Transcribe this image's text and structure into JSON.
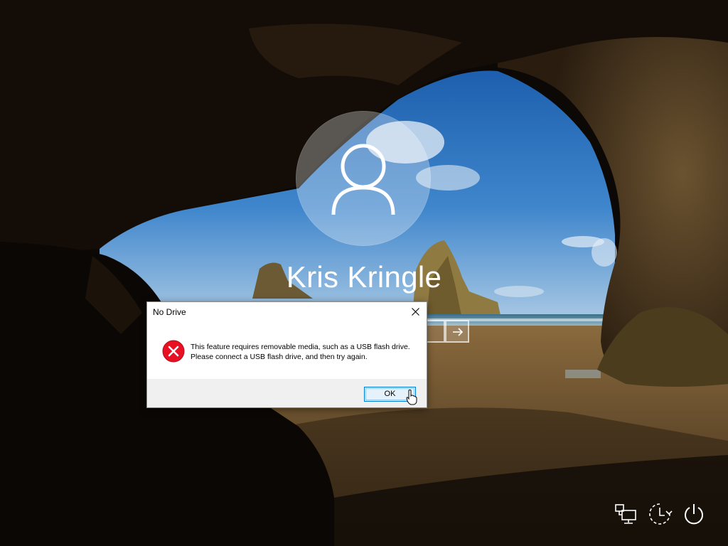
{
  "lock_screen": {
    "user_name": "Kris Kringle",
    "password": {
      "value": "",
      "placeholder": ""
    }
  },
  "dialog": {
    "title": "No Drive",
    "message": "This feature requires removable media, such as a USB flash drive. Please connect a USB flash drive, and then try again.",
    "ok_label": "OK",
    "icon": "error-icon"
  },
  "tray": {
    "icons": [
      "network-icon",
      "ease-of-access-icon",
      "power-icon"
    ]
  },
  "colors": {
    "accent": "#0078d7",
    "error": "#e81123",
    "dialog_footer": "#f0f0f0"
  }
}
